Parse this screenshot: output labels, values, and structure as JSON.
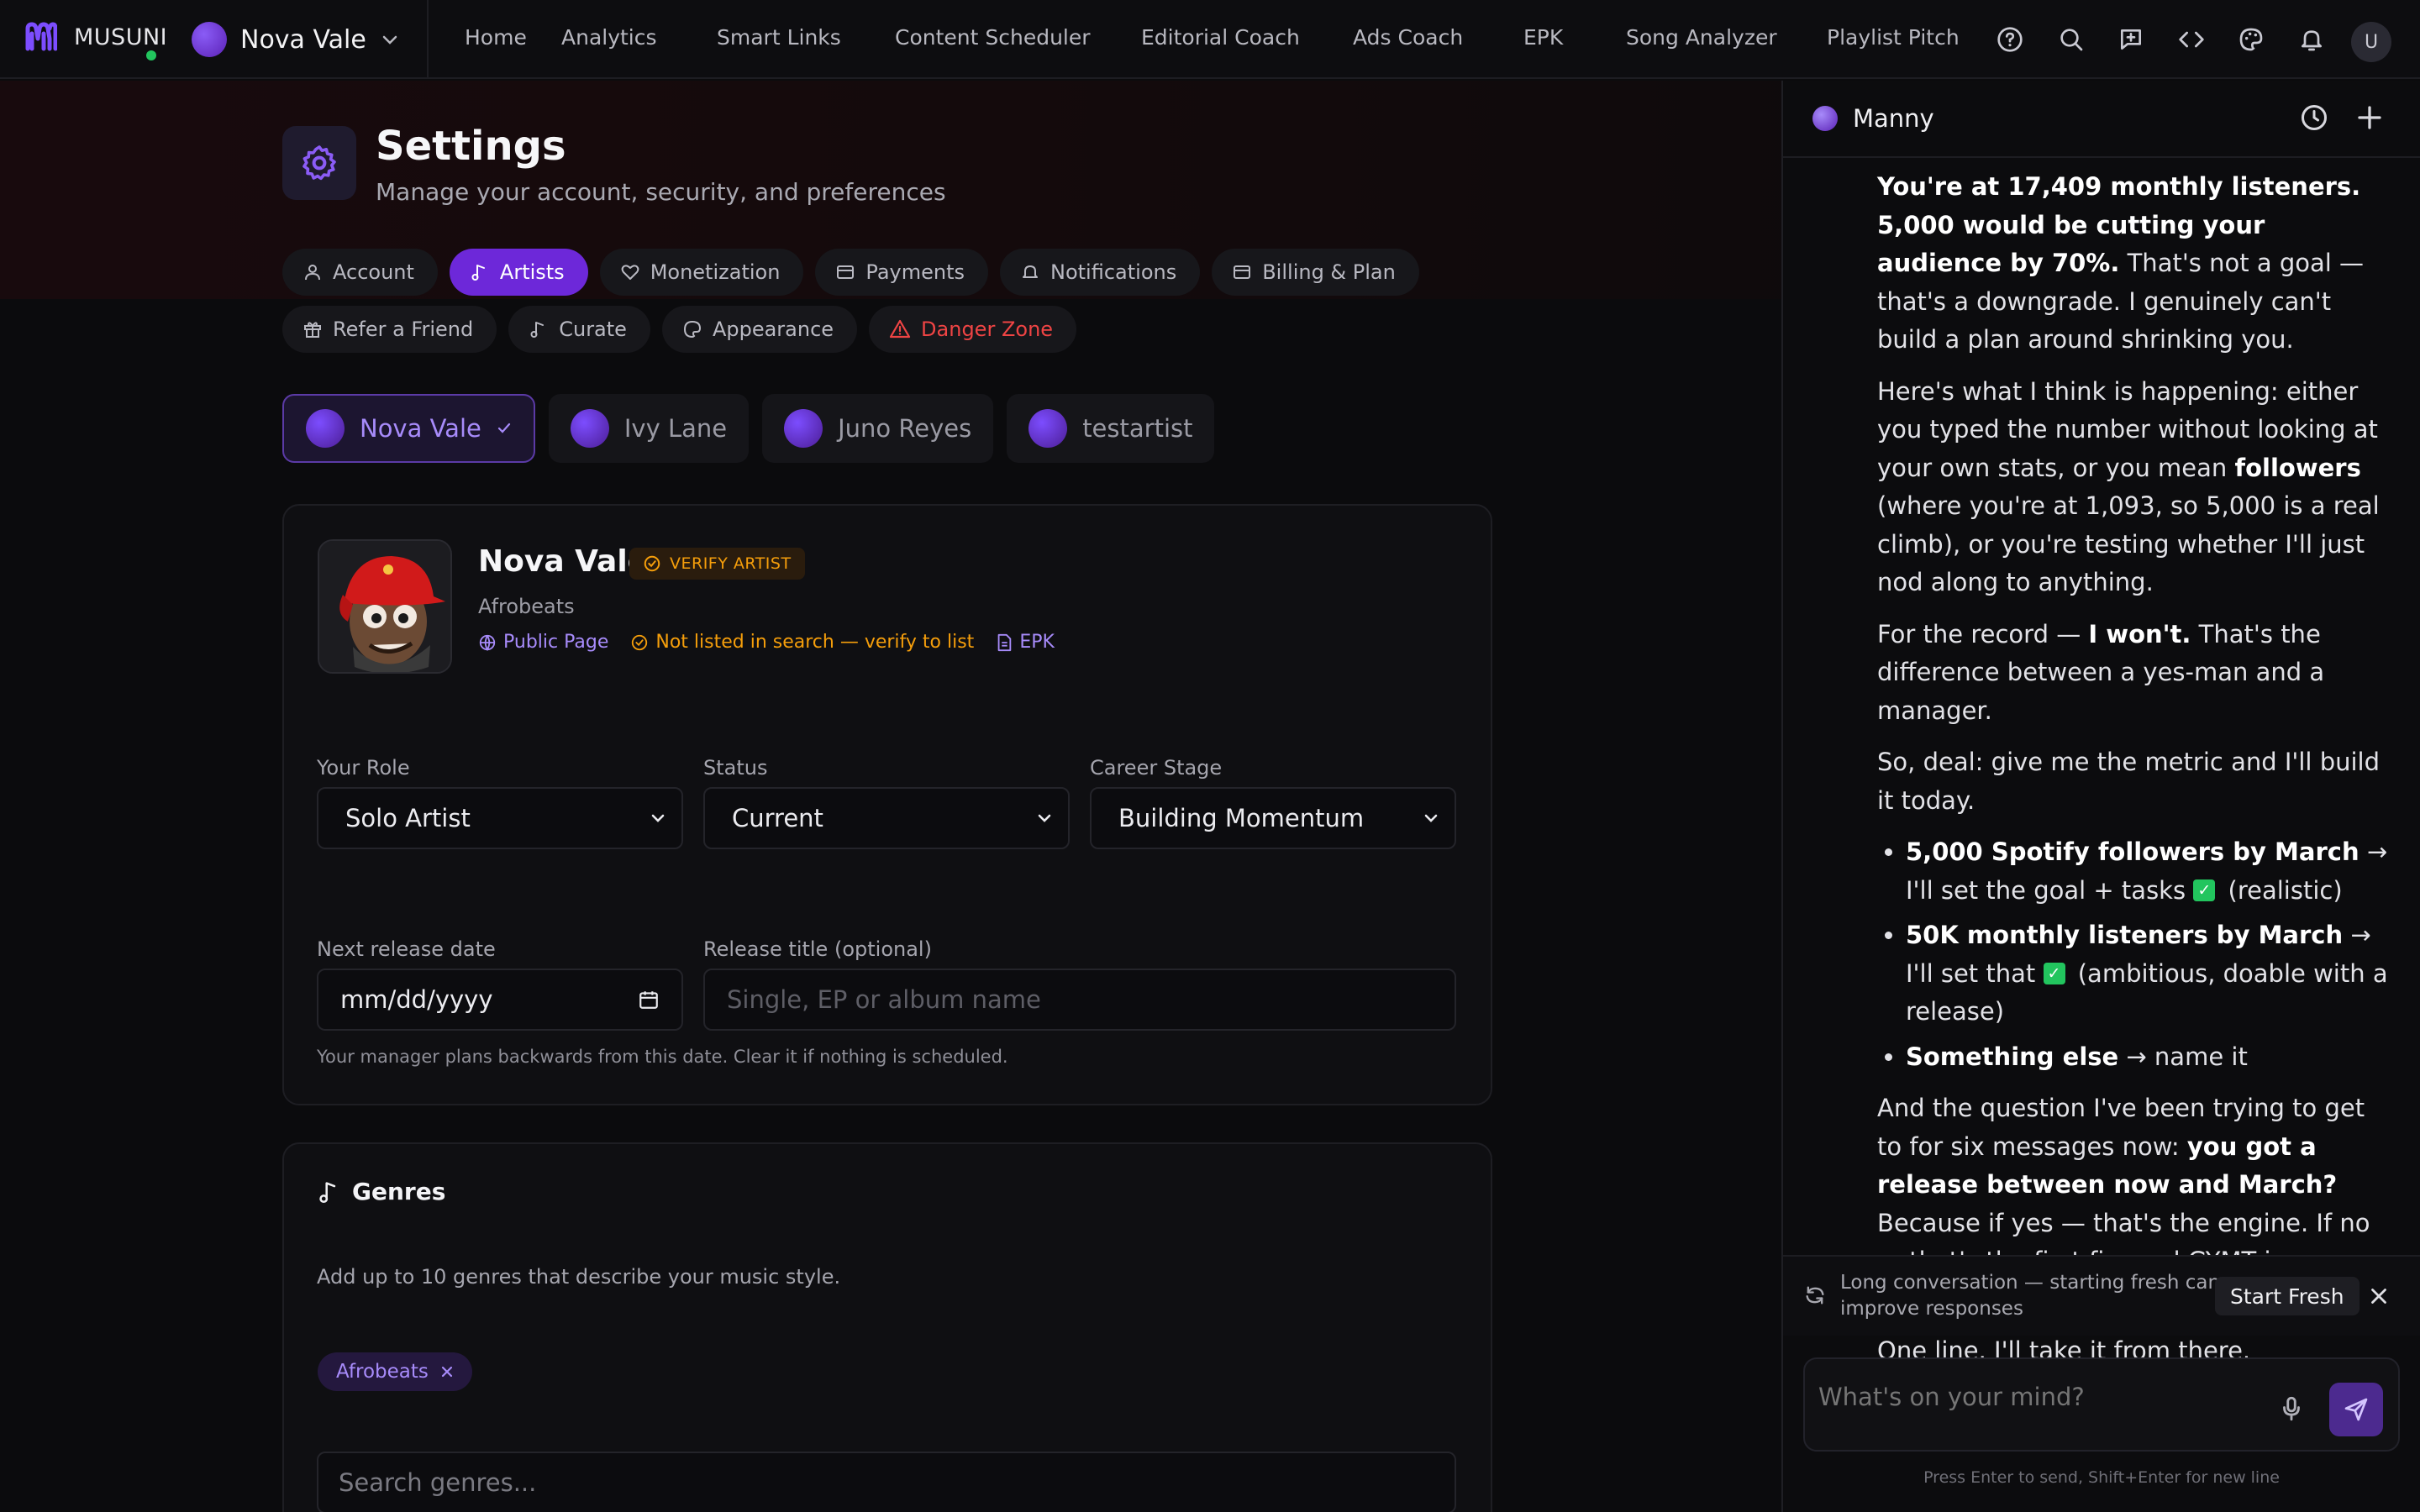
{
  "app": {
    "brand": "MUSUNI",
    "current_artist": "Nova Vale"
  },
  "nav": {
    "links": [
      "Home",
      "Analytics",
      "Smart Links",
      "Content Scheduler",
      "Editorial Coach",
      "Ads Coach",
      "EPK",
      "Song Analyzer",
      "Playlist Pitch"
    ],
    "icons": [
      "help-circle-icon",
      "search-icon",
      "feedback-icon",
      "code-icon",
      "palette-icon",
      "bell-icon"
    ],
    "user_initial": "U"
  },
  "settings": {
    "title": "Settings",
    "subtitle": "Manage your account, security, and preferences",
    "tabs_row1": [
      "Account",
      "Artists",
      "Monetization",
      "Payments",
      "Notifications",
      "Billing & Plan"
    ],
    "tabs_row2": [
      "Refer a Friend",
      "Curate",
      "Appearance",
      "Danger Zone"
    ],
    "active_tab": "Artists"
  },
  "artists": [
    "Nova Vale",
    "Ivy Lane",
    "Juno Reyes",
    "testartist"
  ],
  "profile": {
    "name": "Nova Vale",
    "verify_label": "VERIFY ARTIST",
    "genre": "Afrobeats",
    "link_public": "Public Page",
    "link_search": "Not listed in search — verify to list",
    "link_epk": "EPK"
  },
  "form": {
    "role_label": "Your Role",
    "role_value": "Solo Artist",
    "status_label": "Status",
    "status_value": "Current",
    "stage_label": "Career Stage",
    "stage_value": "Building Momentum",
    "release_date_label": "Next release date",
    "release_date_value": "mm/dd/yyyy",
    "release_title_label": "Release title (optional)",
    "release_title_placeholder": "Single, EP or album name",
    "hint": "Your manager plans backwards from this date. Clear it if nothing is scheduled."
  },
  "genres": {
    "title": "Genres",
    "description": "Add up to 10 genres that describe your music style.",
    "chips": [
      "Afrobeats"
    ],
    "search_placeholder": "Search genres..."
  },
  "chat": {
    "assistant_name": "Manny",
    "p1_bold": "You're at 17,409 monthly listeners. 5,000 would be cutting your audience by 70%.",
    "p1_rest": " That's not a goal — that's a downgrade. I genuinely can't build a plan around shrinking you.",
    "p2_a": "Here's what I think is happening: either you typed the number without looking at your own stats, or you mean ",
    "p2_bold": "followers",
    "p2_b": " (where you're at 1,093, so 5,000 is a real climb), or you're testing whether I'll just nod along to anything.",
    "p3_a": "For the record — ",
    "p3_bold": "I won't.",
    "p3_b": " That's the difference between a yes-man and a manager.",
    "p4": "So, deal: give me the metric and I'll build it today.",
    "b1_bold": "5,000 Spotify followers by March",
    "b1_rest": " → I'll set the goal + tasks",
    "b1_tail": " (realistic)",
    "b2_bold": "50K monthly listeners by March",
    "b2_rest": " → I'll set that",
    "b2_tail": " (ambitious, doable with a release)",
    "b3_bold": "Something else",
    "b3_rest": " → name it",
    "p5_a": "And the question I've been trying to get to for six messages now: ",
    "p5_bold": "you got a release between now and March?",
    "p5_b": " Because if yes — that's the engine. If no — that's the first fix, and GYMT is our bridge until then.",
    "p6": "One line. I'll take it from there.",
    "check_glyph": "✓",
    "notice": "Long conversation — starting fresh can improve responses",
    "start_fresh": "Start Fresh",
    "composer_placeholder": "What's on your mind?",
    "composer_hint": "Press Enter to send, Shift+Enter for new line"
  },
  "colors": {
    "accent": "#6d28d9",
    "warning": "#f59e0b",
    "danger": "#ef4444",
    "success": "#22c55e"
  }
}
